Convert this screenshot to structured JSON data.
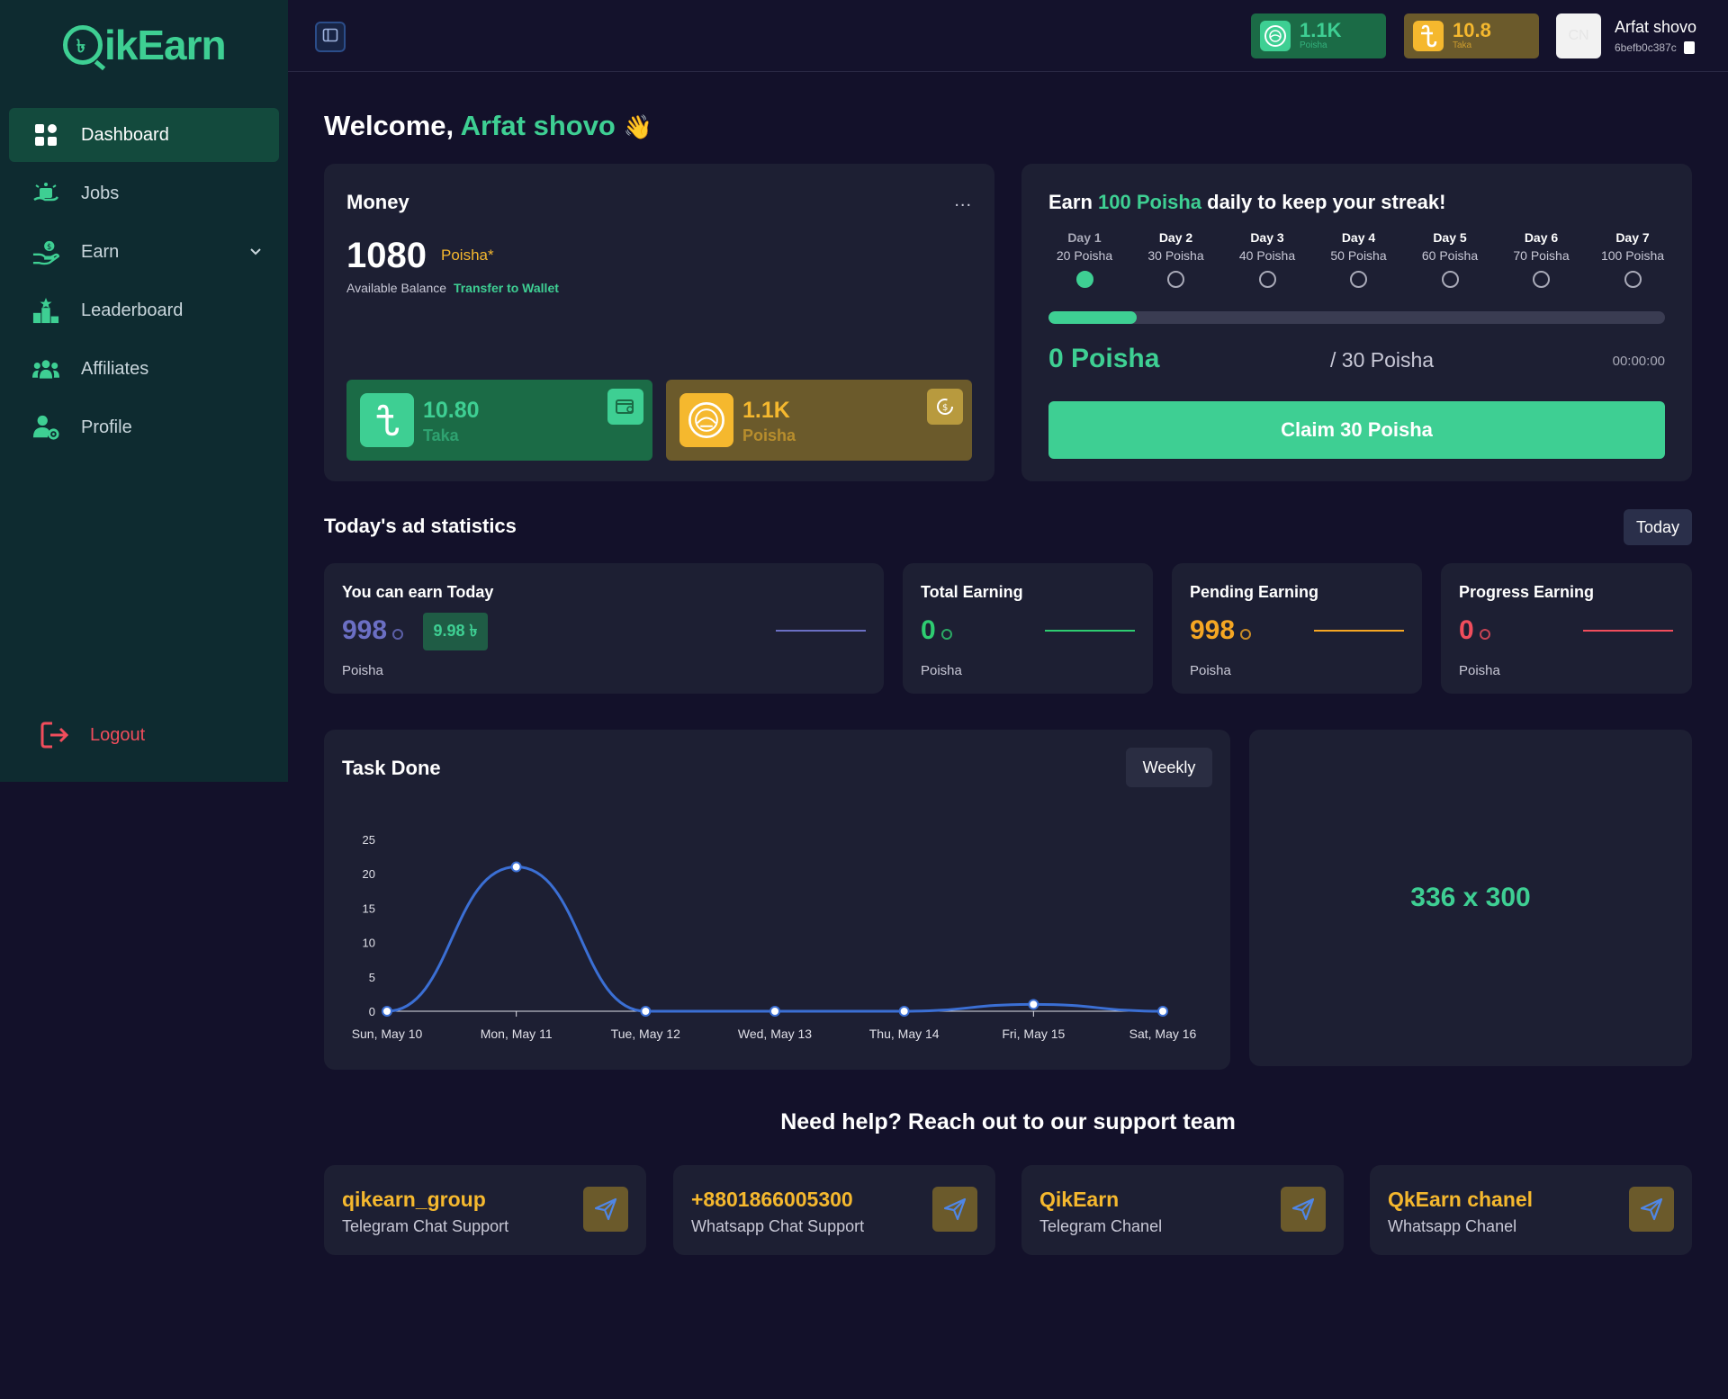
{
  "brand": {
    "logo_text": "ikEarn",
    "logo_q_mark": "৳"
  },
  "sidebar": {
    "items": [
      {
        "label": "Dashboard",
        "icon": "dashboard-grid-icon",
        "active": true
      },
      {
        "label": "Jobs",
        "icon": "jobs-icon"
      },
      {
        "label": "Earn",
        "icon": "earn-hand-coin-icon",
        "has_dropdown": true
      },
      {
        "label": "Leaderboard",
        "icon": "leaderboard-podium-icon"
      },
      {
        "label": "Affiliates",
        "icon": "affiliates-group-icon"
      },
      {
        "label": "Profile",
        "icon": "profile-gear-icon"
      }
    ],
    "logout_label": "Logout"
  },
  "header": {
    "poisha_amount": "1.1K",
    "poisha_label": "Poisha",
    "taka_amount": "10.8",
    "taka_label": "Taka",
    "avatar_initials": "CN",
    "user_name": "Arfat shovo",
    "user_id": "6befb0c387c"
  },
  "welcome": {
    "prefix": "Welcome,",
    "name": "Arfat shovo",
    "emoji": "👋"
  },
  "money": {
    "title": "Money",
    "menu": "...",
    "balance": "1080",
    "balance_unit": "Poisha*",
    "available_label": "Available Balance",
    "transfer_label": "Transfer to Wallet",
    "taka_value": "10.80",
    "taka_label": "Taka",
    "poisha_value": "1.1K",
    "poisha_label": "Poisha"
  },
  "streak": {
    "title_pre": "Earn",
    "title_highlight": "100 Poisha",
    "title_post": "daily to keep your streak!",
    "days": [
      {
        "name": "Day 1",
        "reward": "20 Poisha",
        "done": true
      },
      {
        "name": "Day 2",
        "reward": "30 Poisha",
        "done": false
      },
      {
        "name": "Day 3",
        "reward": "40 Poisha",
        "done": false
      },
      {
        "name": "Day 4",
        "reward": "50 Poisha",
        "done": false
      },
      {
        "name": "Day 5",
        "reward": "60 Poisha",
        "done": false
      },
      {
        "name": "Day 6",
        "reward": "70 Poisha",
        "done": false
      },
      {
        "name": "Day 7",
        "reward": "100 Poisha",
        "done": false
      }
    ],
    "progress_fraction": 0.143,
    "current": "0 Poisha",
    "target": "/ 30 Poisha",
    "timer": "00:00:00",
    "claim_label": "Claim 30 Poisha"
  },
  "stats": {
    "title": "Today's ad statistics",
    "period_label": "Today",
    "cards": [
      {
        "title": "You can earn Today",
        "value": "998",
        "unit": "Poisha",
        "taka": "9.98 ৳",
        "color": "#6b6fc4"
      },
      {
        "title": "Total Earning",
        "value": "0",
        "unit": "Poisha",
        "color": "#2ecc71"
      },
      {
        "title": "Pending Earning",
        "value": "998",
        "unit": "Poisha",
        "color": "#f5a623"
      },
      {
        "title": "Progress Earning",
        "value": "0",
        "unit": "Poisha",
        "color": "#f14d5c"
      }
    ]
  },
  "task_chart": {
    "title": "Task Done",
    "period_label": "Weekly"
  },
  "chart_data": {
    "type": "line",
    "categories": [
      "Sun, May 10",
      "Mon, May 11",
      "Tue, May 12",
      "Wed, May 13",
      "Thu, May 14",
      "Fri, May 15",
      "Sat, May 16"
    ],
    "values": [
      0,
      21,
      0,
      0,
      0,
      1,
      0
    ],
    "yticks": [
      0,
      5,
      10,
      15,
      20,
      25
    ],
    "ylim": [
      0,
      25
    ],
    "title": "",
    "xlabel": "",
    "ylabel": "",
    "line_color": "#3b6fd4",
    "grid": false
  },
  "ad_slot": {
    "label": "336 x 300"
  },
  "support": {
    "title": "Need help? Reach out to our support team",
    "cards": [
      {
        "title": "qikearn_group",
        "subtitle": "Telegram Chat Support"
      },
      {
        "title": "+8801866005300",
        "subtitle": "Whatsapp Chat Support"
      },
      {
        "title": "QikEarn",
        "subtitle": "Telegram Chanel"
      },
      {
        "title": "QkEarn chanel",
        "subtitle": "Whatsapp Chanel"
      }
    ]
  },
  "colors": {
    "accent_green": "#3ecf93",
    "accent_gold": "#f5b82e",
    "danger": "#f14d5c",
    "sidebar_bg": "#0e2b30",
    "page_bg": "#13112a",
    "card_bg": "#1d1f33"
  }
}
